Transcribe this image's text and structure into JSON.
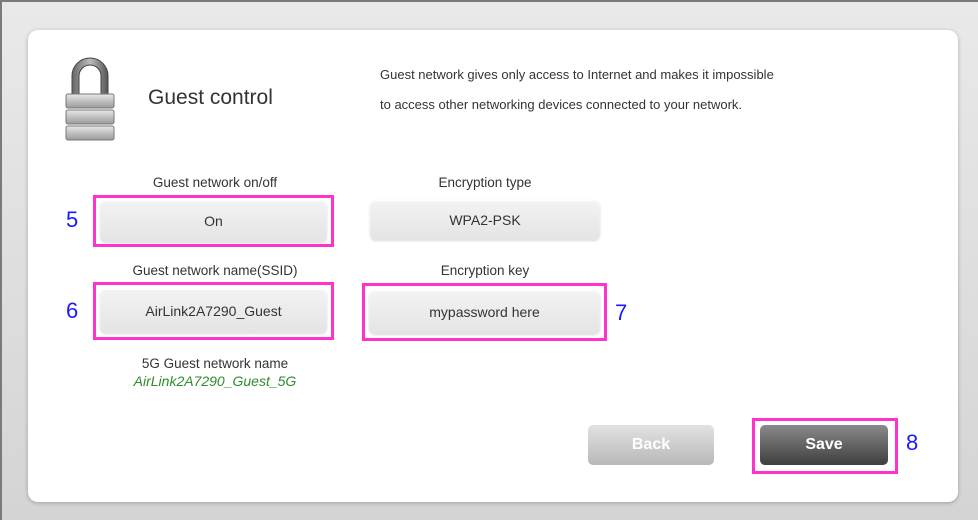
{
  "panel": {
    "title": "Guest control",
    "description": [
      "Guest network gives only access to Internet and makes it impossible",
      "to access other networking devices connected to your network."
    ]
  },
  "guest_network": {
    "label": "Guest network on/off",
    "value": "On"
  },
  "encryption_type": {
    "label": "Encryption type",
    "value": "WPA2-PSK"
  },
  "ssid": {
    "label": "Guest network name(SSID)",
    "value": "AirLink2A7290_Guest"
  },
  "encryption_key": {
    "label": "Encryption key",
    "value": "mypassword here"
  },
  "ssid_5g": {
    "label": "5G Guest network name",
    "value": "AirLink2A7290_Guest_5G"
  },
  "buttons": {
    "back": "Back",
    "save": "Save"
  },
  "markers": {
    "m5": "5",
    "m6": "6",
    "m7": "7",
    "m8": "8"
  },
  "colors": {
    "highlight": "#ff33cc",
    "marker": "#1a1aff",
    "ssid_5g": "#2e8b2e"
  }
}
